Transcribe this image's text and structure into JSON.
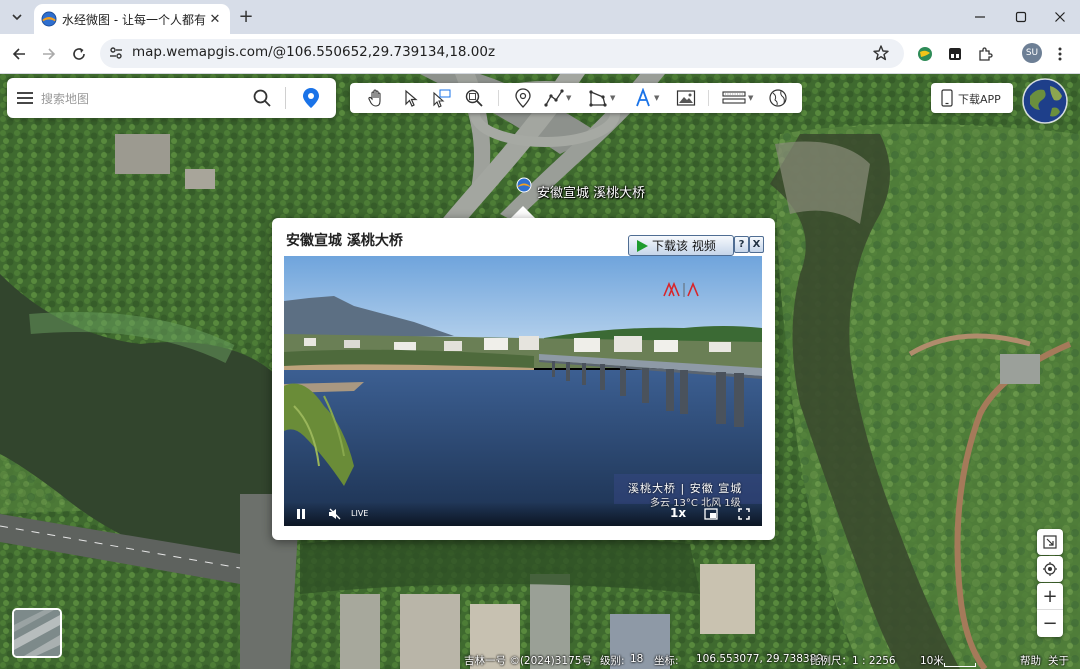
{
  "browser": {
    "tab_title": "水经微图 - 让每一个人都有自己",
    "url": "map.wemapgis.com/@106.550652,29.739134,18.00z",
    "profile_initials": "SU"
  },
  "search": {
    "placeholder": "搜索地图"
  },
  "header": {
    "download_app_label": "下载APP"
  },
  "toolbar": {
    "tools": [
      "pan-icon",
      "select-icon",
      "box-select-icon",
      "zoom-area-icon",
      "point-marker-icon",
      "polyline-icon",
      "polygon-icon",
      "text-icon",
      "image-icon",
      "layers-icon",
      "globe-icon"
    ]
  },
  "marker": {
    "label": "安徽宣城 溪桃大桥"
  },
  "popup": {
    "title": "安徽宣城 溪桃大桥",
    "download_video_label": "下载该 视频",
    "help_label": "?",
    "close_label": "X",
    "video": {
      "osd_line1": "溪桃大桥 | 安徽 宣城",
      "osd_line2": "多云 13°C 北风 1级",
      "live_label": "LIVE",
      "speed_label": "1x"
    }
  },
  "status_bar": {
    "source": "吉林一号 ©(2024)3175号",
    "level_label": "级别:",
    "level_value": "18",
    "coord_label": "坐标:",
    "coord_value": "106.553077, 29.738389",
    "scale_label": "比例尺：1 : 2256",
    "scale_bar_label": "10米",
    "help_link": "帮助",
    "about_link": "关于"
  },
  "colors": {
    "accent_blue": "#1a73e8",
    "popup_button_border": "#4f6d93",
    "play_green": "#1e9b2d"
  }
}
